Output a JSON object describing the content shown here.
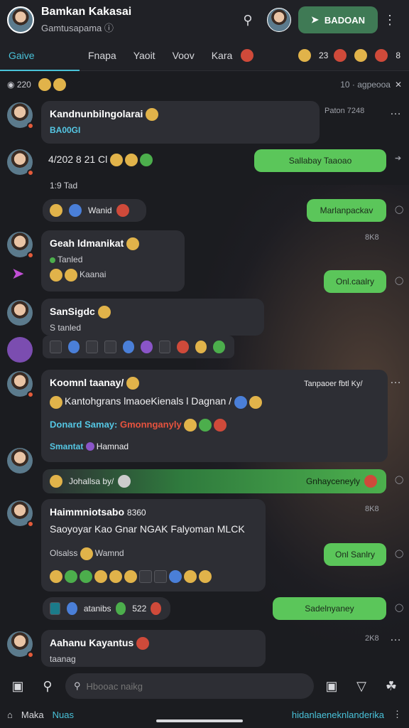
{
  "header": {
    "title": "Bamkan Kakasai",
    "subtitle": "Gamtusapama",
    "subtitle_icon": "info-icon",
    "action_label": "BADOAN"
  },
  "tabs": [
    "Gaive",
    "Fnapa",
    "Yaoit",
    "Voov",
    "Kara"
  ],
  "tab_badges": {
    "count": "23",
    "right": "8"
  },
  "status": {
    "left_count": "220",
    "right_text": "10 · agpeooa"
  },
  "messages": [
    {
      "name": "Kandnunbilngolarai",
      "tag": "BA00GI",
      "meta": "Paton 7248"
    },
    {
      "name": "4/202 8 21 Cl",
      "sub": "1:9 Tad",
      "out": "Sallabay Taaoao",
      "chip": "Wanid"
    },
    {
      "out2": "Marlanpackav"
    },
    {
      "name": "Geah ldmanikat",
      "sub": "Tanled",
      "inner": "Kaanai",
      "meta": "8K8",
      "out": "Onl.caalry"
    },
    {
      "name": "SanSigdc",
      "sub": "S tanled"
    },
    {
      "name": "Koomnl taanay/",
      "line2": "Kantohgrans lmaoeKienals l Dagnan /",
      "line3a": "Donard Samay:",
      "line3b": "Gmonnganyly",
      "line4a": "Smantat",
      "line4b": "Hamnad",
      "meta": "Tanpaoer fbtl Ky/"
    },
    {
      "bar_left": "Johallsa by/",
      "bar_right": "Gnhayceneyly"
    },
    {
      "name": "Haimmniotsabo",
      "extra": "8360",
      "line2": "Saoyoyar Kao Gnar NGAK Falyoman MLCK",
      "line3a": "Olsalss",
      "line3b": "Wamnd",
      "meta": "8K8",
      "out": "Onl Sanlry"
    },
    {
      "chip2": "atanibs",
      "chip2n": "522",
      "out": "Sadelnyaney"
    },
    {
      "name": "Aahanu Kayantus",
      "sub": "taanag",
      "meta": "2K8"
    }
  ],
  "input": {
    "placeholder": "Hbooac naikg"
  },
  "bottom": {
    "left": "Maka",
    "left2": "Nuas",
    "right": "hidanlaeneknlanderika"
  }
}
